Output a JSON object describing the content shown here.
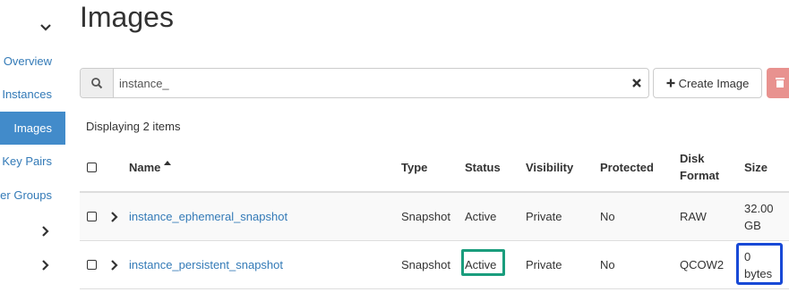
{
  "sidebar": {
    "items": [
      {
        "label": "Overview",
        "active": false
      },
      {
        "label": "Instances",
        "active": false
      },
      {
        "label": "Images",
        "active": true
      },
      {
        "label": "Key Pairs",
        "active": false
      },
      {
        "label": "Server Groups",
        "active": false
      }
    ]
  },
  "page": {
    "title": "Images"
  },
  "search": {
    "value": "instance_",
    "placeholder": ""
  },
  "toolbar": {
    "create_label": "Create Image"
  },
  "table": {
    "count_text": "Displaying 2 items",
    "columns": {
      "name": "Name",
      "type": "Type",
      "status": "Status",
      "visibility": "Visibility",
      "protected": "Protected",
      "disk_format_1": "Disk",
      "disk_format_2": "Format",
      "size": "Size"
    },
    "rows": [
      {
        "name": "instance_ephemeral_snapshot",
        "type": "Snapshot",
        "status": "Active",
        "visibility": "Private",
        "protected": "No",
        "disk_format": "RAW",
        "size_1": "32.00",
        "size_2": "GB"
      },
      {
        "name": "instance_persistent_snapshot",
        "type": "Snapshot",
        "status": "Active",
        "visibility": "Private",
        "protected": "No",
        "disk_format": "QCOW2",
        "size_1": "0",
        "size_2": "bytes"
      }
    ]
  },
  "colors": {
    "accent": "#428bca",
    "link": "#337ab7",
    "danger": "#e8928f",
    "highlight_green": "#1a9d7d",
    "highlight_blue": "#1849d6"
  }
}
